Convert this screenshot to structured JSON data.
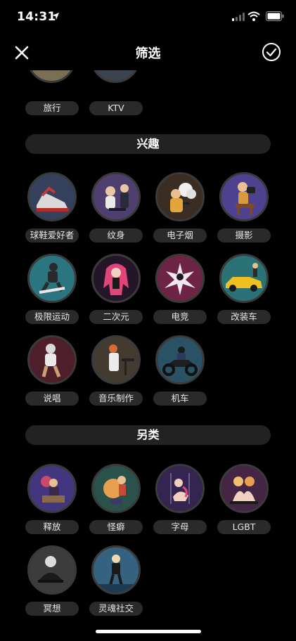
{
  "status": {
    "time": "14:31"
  },
  "nav": {
    "title": "筛选"
  },
  "partial_section": {
    "items": [
      {
        "label": "旅行",
        "icon": "travel-icon"
      },
      {
        "label": "KTV",
        "icon": "ktv-icon"
      }
    ]
  },
  "interests": {
    "header": "兴趣",
    "items": [
      {
        "label": "球鞋爱好者",
        "icon": "sneaker-icon"
      },
      {
        "label": "纹身",
        "icon": "tattoo-icon"
      },
      {
        "label": "电子烟",
        "icon": "vape-icon"
      },
      {
        "label": "摄影",
        "icon": "camera-icon"
      },
      {
        "label": "极限运动",
        "icon": "extreme-sport-icon"
      },
      {
        "label": "二次元",
        "icon": "anime-icon"
      },
      {
        "label": "电竞",
        "icon": "esports-icon"
      },
      {
        "label": "改装车",
        "icon": "modified-car-icon"
      },
      {
        "label": "说唱",
        "icon": "rap-icon"
      },
      {
        "label": "音乐制作",
        "icon": "music-production-icon"
      },
      {
        "label": "机车",
        "icon": "motorcycle-icon"
      }
    ]
  },
  "alternative": {
    "header": "另类",
    "items": [
      {
        "label": "释放",
        "icon": "release-icon"
      },
      {
        "label": "怪癖",
        "icon": "fetish-icon"
      },
      {
        "label": "字母",
        "icon": "letters-icon"
      },
      {
        "label": "LGBT",
        "icon": "lgbt-icon"
      },
      {
        "label": "冥想",
        "icon": "meditation-icon"
      },
      {
        "label": "灵魂社交",
        "icon": "soul-social-icon"
      }
    ]
  },
  "colors": {
    "background": "#000000",
    "section_bg": "#222222",
    "chip_bg": "#2a2a2a",
    "circle_border": "#3a3a3a"
  }
}
